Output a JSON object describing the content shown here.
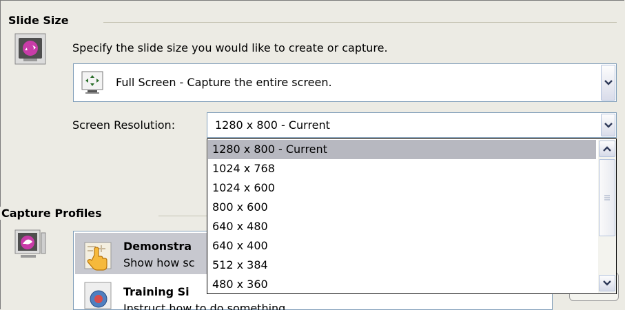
{
  "slide_size": {
    "group_title": "Slide Size",
    "instruction": "Specify the slide size you would like to create or capture.",
    "mode_combo": {
      "value": "Full Screen - Capture the entire screen."
    },
    "resolution": {
      "label": "Screen Resolution:",
      "value": "1280 x 800 - Current",
      "options": [
        "1280 x 800 - Current",
        "1024 x 768",
        "1024 x 600",
        "800 x 600",
        "640 x 480",
        "640 x 400",
        "512 x 384",
        "480 x 360"
      ],
      "selected_option": "1280 x 800 - Current"
    }
  },
  "capture_profiles": {
    "group_title": "Capture Profiles",
    "items": [
      {
        "title": "Demonstra",
        "desc": "Show how sc"
      },
      {
        "title": "Training Si",
        "desc": "Instruct how to do something"
      }
    ]
  },
  "colors": {
    "background": "#ecebe4",
    "selection": "#b7b8c0",
    "border": "#7f9db9"
  }
}
